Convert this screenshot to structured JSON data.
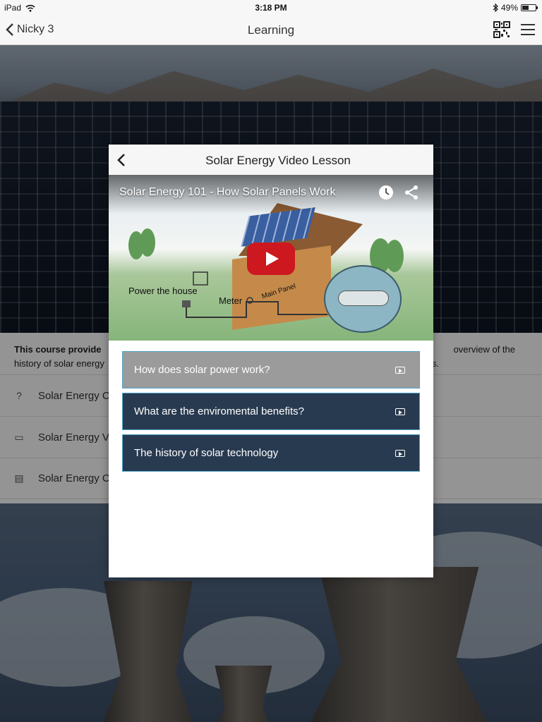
{
  "status_bar": {
    "device": "iPad",
    "time": "3:18 PM",
    "battery": "49%",
    "battery_level": 0.49,
    "wifi_icon": "wifi-icon",
    "bluetooth_icon": "bluetooth-icon"
  },
  "nav": {
    "back_label": "Nicky 3",
    "title": "Learning",
    "qr_icon": "qr-code-icon",
    "menu_icon": "hamburger-menu-icon"
  },
  "course": {
    "description_bold": "This course provide",
    "description_right_1": "overview of the",
    "description_line2_left": "history of solar energy",
    "description_line2_right": "s.",
    "items": [
      {
        "icon": "?",
        "icon_name": "question-icon",
        "label": "Solar Energy C"
      },
      {
        "icon": "▭",
        "icon_name": "monitor-icon",
        "label": "Solar Energy V"
      },
      {
        "icon": "▤",
        "icon_name": "clipboard-icon",
        "label": "Solar Energy C"
      }
    ]
  },
  "modal": {
    "title": "Solar Energy Video Lesson",
    "back_icon": "chevron-left-icon",
    "video": {
      "title": "Solar Energy 101 - How Solar Panels Work",
      "label_power": "Power the house",
      "label_meter": "Meter",
      "label_panel": "Main Panel",
      "watch_later_icon": "clock-icon",
      "share_icon": "share-icon",
      "play_icon": "youtube-play-icon"
    },
    "topics": [
      {
        "label": "How does solar power work?",
        "active": true
      },
      {
        "label": "What are the enviromental benefits?",
        "active": false
      },
      {
        "label": "The history of solar technology",
        "active": false
      }
    ]
  },
  "colors": {
    "topic_bg": "#283a50",
    "topic_active_bg": "#9b9b9b",
    "topic_border": "#4fa3c8",
    "play_red": "#cc181e"
  }
}
